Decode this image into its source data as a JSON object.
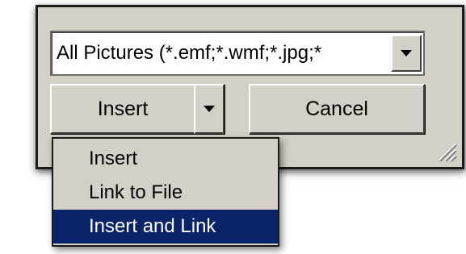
{
  "file_type_filter": {
    "value": "All Pictures (*.emf;*.wmf;*.jpg;*",
    "arrow_icon": "chevron-down-icon"
  },
  "buttons": {
    "insert_label": "Insert",
    "cancel_label": "Cancel"
  },
  "insert_menu": {
    "items": [
      {
        "label": "Insert"
      },
      {
        "label": "Link to File"
      },
      {
        "label": "Insert and Link"
      }
    ],
    "selected_item": "Insert and Link"
  },
  "colors": {
    "dialog_face": "#d4d0c8",
    "selection": "#0a246a",
    "selection_text": "#ffffff"
  }
}
